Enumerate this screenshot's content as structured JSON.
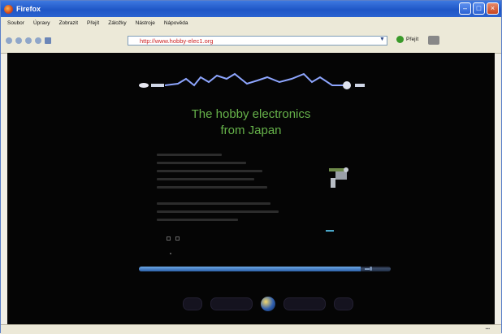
{
  "window": {
    "title": "Firefox"
  },
  "menu": [
    "Soubor",
    "Úpravy",
    "Zobrazit",
    "Přejít",
    "Záložky",
    "Nástroje",
    "Nápověda"
  ],
  "address": {
    "url": "http://www.hobby-elec1.org"
  },
  "toolbar": {
    "go_label": "Přejít"
  },
  "page": {
    "hero_line1": "The hobby electronics",
    "hero_line2": "from Japan"
  },
  "progress": {
    "fraction": 0.88
  },
  "colors": {
    "titlebar": "#2a62cf",
    "hero_text": "#66b24a",
    "page_bg": "#050505"
  },
  "icons": [
    "firefox-icon",
    "back-icon",
    "forward-icon",
    "reload-icon",
    "stop-icon",
    "home-icon",
    "go-icon",
    "search-icon",
    "faucet-icon",
    "globe-icon"
  ]
}
